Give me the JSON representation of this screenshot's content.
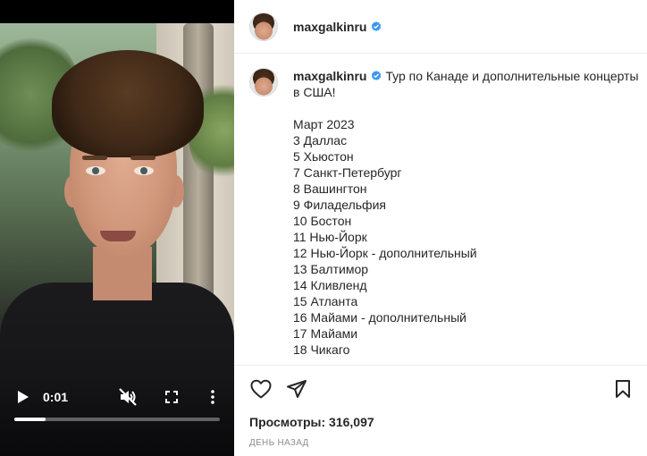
{
  "video": {
    "time": "0:01",
    "progress": 0.15,
    "icons": {
      "play": "play-icon",
      "mute": "speaker-muted-icon",
      "fullscreen": "fullscreen-icon",
      "more": "more-vertical-icon"
    }
  },
  "header": {
    "username": "maxgalkinru",
    "verified_icon": "verified-badge-icon"
  },
  "caption": {
    "username": "maxgalkinru",
    "text": "Тур по Канаде и дополнительные концерты в США!",
    "month": "Март 2023",
    "dates": [
      "3 Даллас",
      "5 Хьюстон",
      "7 Санкт-Петербург",
      "8 Вашингтон",
      "9 Филадельфия",
      "10 Бостон",
      "11 Нью-Йорк",
      "12 Нью-Йорк - дополнительный",
      "13 Балтимор",
      "14 Кливленд",
      "15 Атланта",
      "16 Майами - дополнительный",
      "17 Майами",
      "18 Чикаго"
    ]
  },
  "actions": {
    "like_icon": "heart-icon",
    "share_icon": "paper-plane-icon",
    "save_icon": "bookmark-icon"
  },
  "stats": {
    "views": "Просмотры: 316,097",
    "posted": "ДЕНЬ НАЗАД"
  },
  "colors": {
    "verified": "#3897f0",
    "text": "#262626",
    "secondary": "#8e8e8e",
    "divider": "#efefef"
  }
}
